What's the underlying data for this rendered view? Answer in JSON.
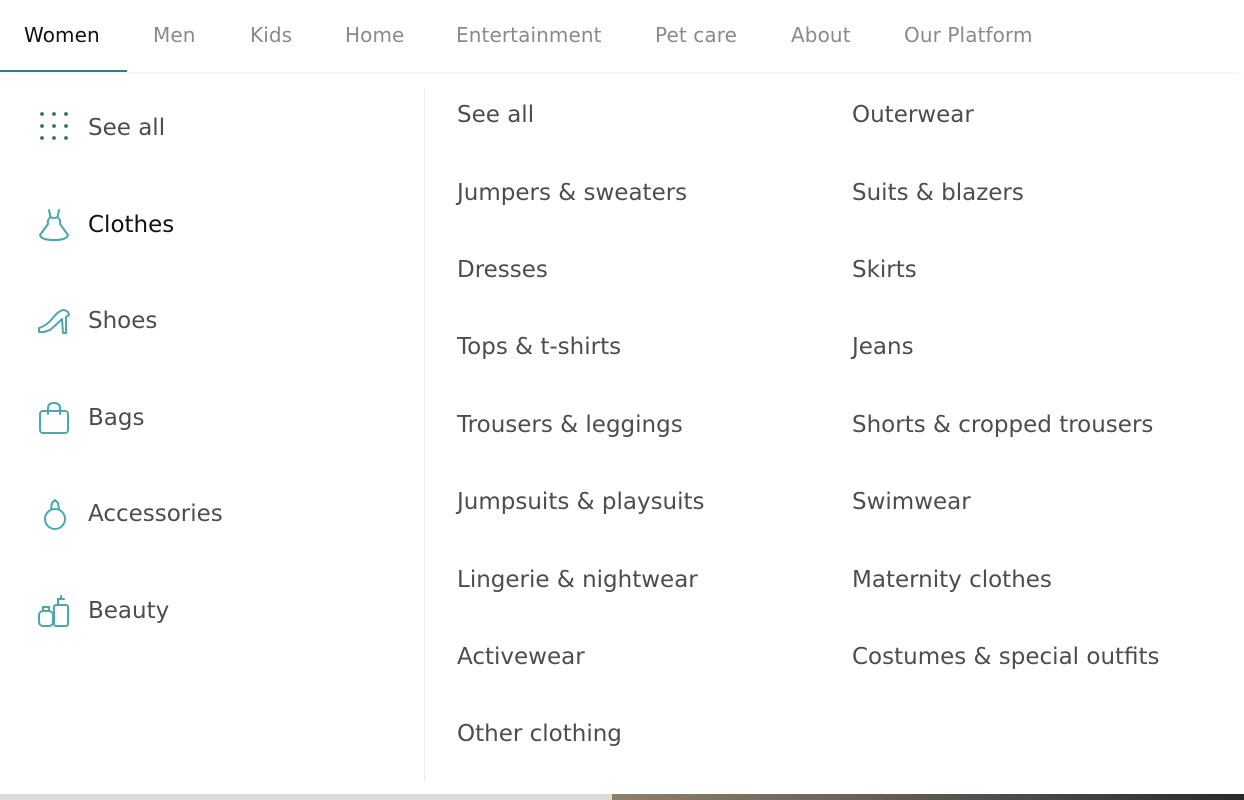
{
  "nav": {
    "tabs": [
      {
        "label": "Women",
        "active": true
      },
      {
        "label": "Men"
      },
      {
        "label": "Kids"
      },
      {
        "label": "Home"
      },
      {
        "label": "Entertainment"
      },
      {
        "label": "Pet care"
      },
      {
        "label": "About"
      },
      {
        "label": "Our Platform"
      }
    ],
    "accent_color": "#2e7f86"
  },
  "categories": [
    {
      "label": "See all",
      "icon": "grid-dots-icon"
    },
    {
      "label": "Clothes",
      "icon": "dress-icon",
      "active": true
    },
    {
      "label": "Shoes",
      "icon": "high-heel-icon"
    },
    {
      "label": "Bags",
      "icon": "bag-icon"
    },
    {
      "label": "Accessories",
      "icon": "ring-icon"
    },
    {
      "label": "Beauty",
      "icon": "perfume-icon"
    }
  ],
  "subcategories": {
    "left": [
      "See all",
      "Jumpers & sweaters",
      "Dresses",
      "Tops & t-shirts",
      "Trousers & leggings",
      "Jumpsuits & playsuits",
      "Lingerie & nightwear",
      "Activewear",
      "Other clothing"
    ],
    "right": [
      "Outerwear",
      "Suits & blazers",
      "Skirts",
      "Jeans",
      "Shorts & cropped trousers",
      "Swimwear",
      "Maternity clothes",
      "Costumes & special outfits"
    ]
  },
  "icon_color": "#4aa8ae"
}
